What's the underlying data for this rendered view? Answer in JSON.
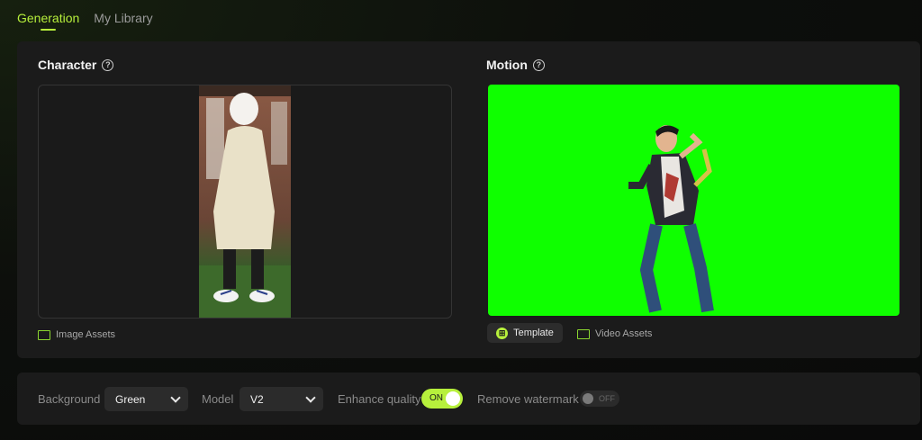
{
  "tabs": [
    {
      "label": "Generation",
      "active": true
    },
    {
      "label": "My Library",
      "active": false
    }
  ],
  "character": {
    "title": "Character",
    "help_icon": "question-circle-icon",
    "assets_label": "Image Assets"
  },
  "motion": {
    "title": "Motion",
    "help_icon": "question-circle-icon",
    "template_label": "Template",
    "assets_label": "Video Assets",
    "background_color": "#0fff00"
  },
  "settings": {
    "background_label": "Background",
    "background_value": "Green",
    "model_label": "Model",
    "model_value": "V2",
    "enhance_label": "Enhance quality",
    "enhance_state": "ON",
    "watermark_label": "Remove watermark",
    "watermark_state": "OFF"
  },
  "colors": {
    "accent": "#b7f03c",
    "panel": "#1b1b1b",
    "background": "#0d0d0d"
  }
}
